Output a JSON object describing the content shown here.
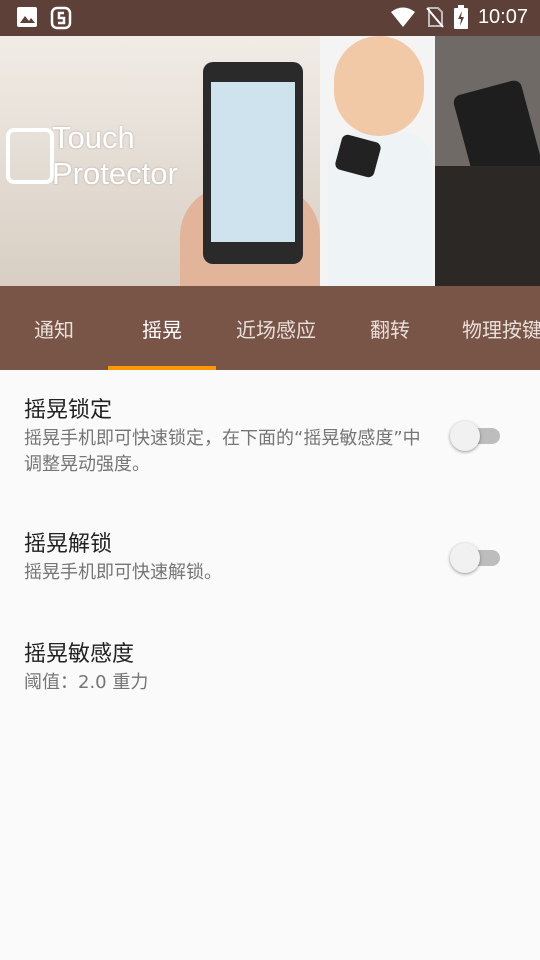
{
  "status_bar": {
    "time": "10:07",
    "left_icons": [
      "image-icon",
      "app-notification-icon"
    ],
    "right_icons": [
      "wifi-icon",
      "no-sim-icon",
      "battery-charging-icon"
    ]
  },
  "banner": {
    "logo_text_line1": "Touch",
    "logo_text_line2": "Protector"
  },
  "tabs": {
    "items": [
      "通知",
      "摇晃",
      "近场感应",
      "翻转",
      "物理按键"
    ],
    "active_index": 1
  },
  "settings": {
    "shake_lock": {
      "title": "摇晃锁定",
      "summary": "摇晃手机即可快速锁定，在下面的“摇晃敏感度”中调整晃动强度。",
      "enabled": false
    },
    "shake_unlock": {
      "title": "摇晃解锁",
      "summary": "摇晃手机即可快速解锁。",
      "enabled": false
    },
    "sensitivity": {
      "title": "摇晃敏感度",
      "summary": "阈值：2.0 重力"
    }
  },
  "colors": {
    "status_bar": "#5d4037",
    "tab_bar": "#795548",
    "tab_indicator": "#ff9800",
    "background": "#fafafa"
  }
}
